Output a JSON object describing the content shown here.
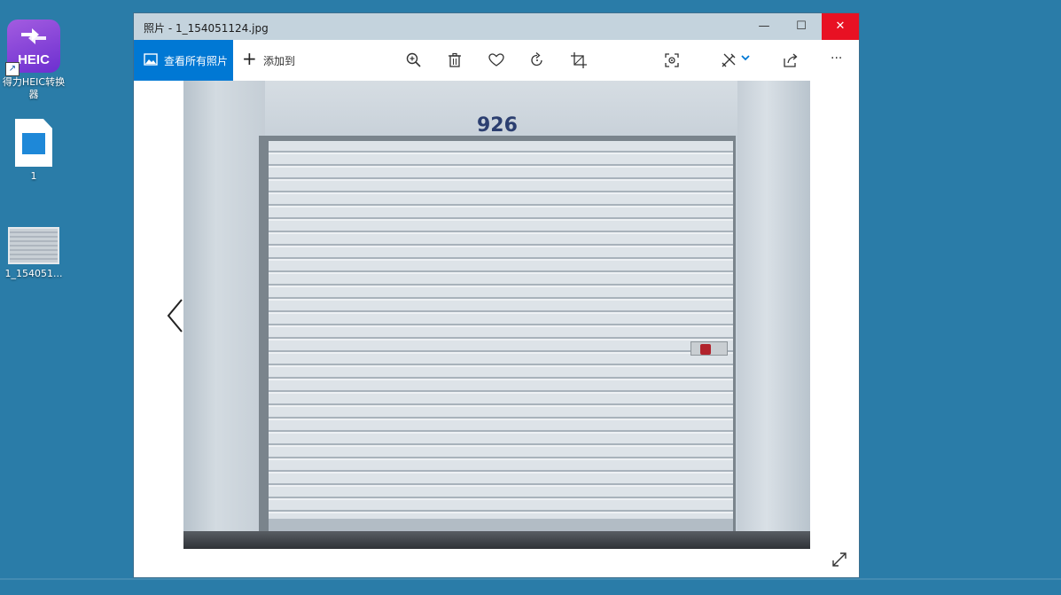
{
  "desktop": {
    "icons": [
      {
        "label": "得力HEIC转换器",
        "badge": "HEIC"
      },
      {
        "label": "1"
      },
      {
        "label": "1_154051..."
      }
    ]
  },
  "window": {
    "title": "照片 - 1_154051124.jpg",
    "controls": {
      "minimize": "—",
      "maximize": "☐",
      "close": "✕"
    }
  },
  "toolbar": {
    "view_all_label": "查看所有照片",
    "add_to_label": "添加到",
    "add_icon": "+",
    "more_label": "···"
  },
  "photo": {
    "door_number": "926"
  },
  "colors": {
    "accent": "#0078d4",
    "close": "#e81123",
    "titlebar": "#c4d3dd",
    "desktop": "#2a7ca8"
  }
}
